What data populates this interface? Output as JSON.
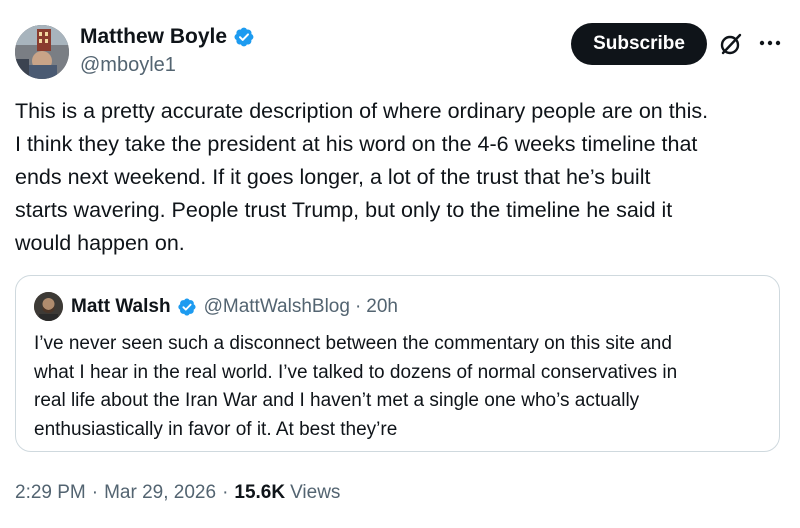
{
  "post": {
    "author_name": "Matthew Boyle",
    "author_handle": "@mboyle1",
    "subscribe_label": "Subscribe",
    "text": "This is a pretty accurate description of where ordinary people are on this.\nI think they take the president at his word on the 4-6 weeks timeline that\nends next weekend. If it goes longer, a lot of the trust that he’s built\nstarts wavering. People trust Trump, but only to the timeline he said it\nwould happen on."
  },
  "quote": {
    "author_name": "Matt Walsh",
    "author_handle": "@MattWalshBlog",
    "separator": "·",
    "time_ago": "20h",
    "text": "I’ve never seen such a disconnect between the commentary on this site and\nwhat I hear in the real world. I’ve talked to dozens of normal conservatives in\nreal life about the Iran War and I haven’t met a single one who’s actually\nenthusiastically in favor of it. At best they’re"
  },
  "meta": {
    "time": "2:29 PM",
    "separator": "·",
    "date": "Mar 29, 2026",
    "views_count": "15.6K",
    "views_label": "Views"
  },
  "icons": {
    "verified": "verified-badge-icon",
    "grok": "grok-icon",
    "more": "more-icon"
  },
  "colors": {
    "text_primary": "#0f1419",
    "text_secondary": "#536471",
    "verified_blue": "#1d9bf0",
    "border": "#cfd9de",
    "button_bg": "#0f1419"
  }
}
